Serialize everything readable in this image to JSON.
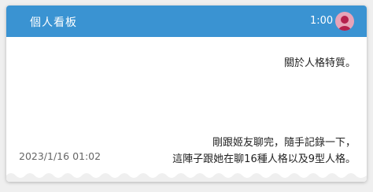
{
  "header": {
    "avatar_icon": "user-avatar-icon",
    "time": "1:00",
    "title": "個人看板"
  },
  "note": {
    "lines": [
      "關於人格特質。",
      "剛跟姬友聊完，隨手記錄一下，",
      "這陣子跟她在聊16種人格以及9型人格。"
    ],
    "timestamp": "2023/1/16 01:02"
  },
  "colors": {
    "header_bg": "#3a93d2",
    "avatar_bg": "#e7a3b8",
    "avatar_fg": "#b5204d",
    "page_bg": "#efefef"
  }
}
